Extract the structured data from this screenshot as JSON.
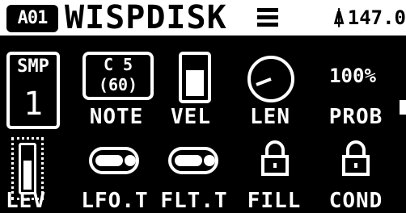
{
  "header": {
    "pattern": "A01",
    "title": "WISPDISK",
    "menu_icon": "hamburger-menu-icon",
    "tempo_icon": "metronome-icon",
    "tempo": "147.0"
  },
  "params_row1": {
    "smp_label": "SMP",
    "smp_value": "1",
    "note_value": "C 5",
    "note_sub": "(60)",
    "note_label": "NOTE",
    "vel_label": "VEL",
    "vel_level": 0.7,
    "len_label": "LEN",
    "prob_value": "100%",
    "prob_label": "PROB"
  },
  "params_row2": {
    "lev_label": "LEV",
    "lev_level": 0.7,
    "lfot_label": "LFO.T",
    "fltt_label": "FLT.T",
    "fill_label": "FILL",
    "cond_label": "COND"
  },
  "icons": {
    "lock": "lock-icon",
    "toggle": "toggle-icon",
    "knob": "knob-icon"
  }
}
